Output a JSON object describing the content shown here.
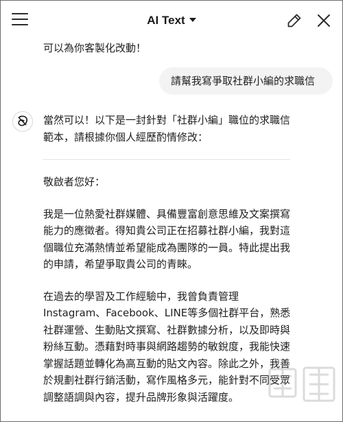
{
  "header": {
    "title": "AI Text"
  },
  "conversation": {
    "previous_fragment": "可以為你客製化改動！",
    "user_message": "請幫我寫爭取社群小編的求職信",
    "assistant": {
      "intro": "當然可以！以下是一封針對「社群小編」職位的求職信範本，請根據你個人經歷酌情修改：",
      "greeting": "敬啟者您好：",
      "paragraph_1": "我是一位熱愛社群媒體、具備豐富創意思維及文案撰寫能力的應徵者。得知貴公司正在招募社群小編，我對這個職位充滿熱情並希望能成為團隊的一員。特此提出我的申請，希望爭取貴公司的青睞。",
      "paragraph_2": "在過去的學習及工作經驗中，我曾負責管理Instagram、Facebook、LINE等多個社群平台，熟悉社群運營、生動貼文撰寫、社群數據分析，以及即時與粉絲互動。憑藉對時事與網路趨勢的敏銳度，我能快速掌握話題並轉化為高互動的貼文內容。除此之外，我善於規劃社群行銷活動，寫作風格多元，能針對不同受眾調整語調與內容，提升品牌形象與活躍度。"
    }
  },
  "icons": {
    "menu": "hamburger-menu-icon",
    "dropdown": "chevron-down-icon",
    "edit": "pencil-icon",
    "close": "close-icon",
    "assistant_avatar": "assistant-logo-icon"
  }
}
